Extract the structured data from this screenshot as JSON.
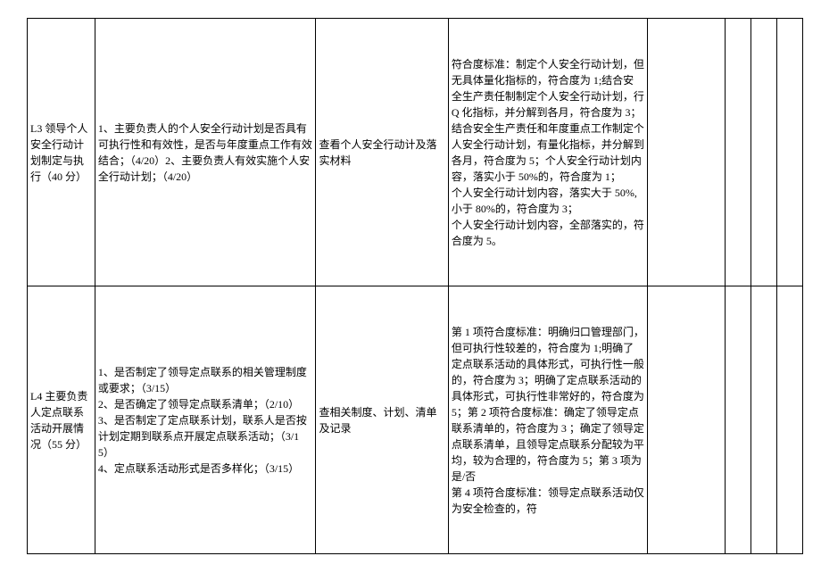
{
  "rows": [
    {
      "col1": "L3 领导个人安全行动计划制定与执行（40 分）",
      "col2": "1、主要负责人的个人安全行动计划是否具有可执行性和有效性，是否与年度重点工作有效结合；（4/20）2、主要负责人有效实施个人安全行动计划；（4/20）",
      "col3": "查看个人安全行动计及落实材料",
      "col4": "符合度标准：制定个人安全行动计划，但无具体量化指标的，符合度为 1;结合安全生产责任制制定个人安全行动计划，行 Q 化指标，并分解到各月，符合度为 3；结合安全生产责任和年度重点工作制定个人安全行动计划，有量化指标，并分解到各月，符合度为 5；个人安全行动计划内容，落实小于 50%的，符合度为 1；\n个人安全行动计划内容，落实大于 50%,小于 80%的，符合度为 3；\n个人安全行动计划内容，全部落实的，符合度为 5。",
      "col5": "",
      "col6": "",
      "col7": "",
      "col8": ""
    },
    {
      "col1": "L4 主要负责人定点联系活动开展情况（55 分）",
      "col2": "1、是否制定了领导定点联系的相关管理制度或要求；（3/15）\n2、是否确定了领导定点联系清单；（2/10）\n3、是否制定了定点联系计划，联系人是否按计划定期到联系点开展定点联系活动；（3/15）\n4、定点联系活动形式是否多样化；（3/15）",
      "col3": "查相关制度、计划、清单及记录",
      "col4": "第 1 项符合度标准：明确归口管理部门，但可执行性较差的，符合度为 1;明确了定点联系活动的具体形式，可执行性一般的，符合度为 3；明确了定点联系活动的具体形式，可执行性非常好的，符合度为 5；第 2 项符合度标准：确定了领导定点联系清单的，符合度为 3 ；确定了领导定点联系清单，且领导定点联系分配较为平均，较为合理的，符合度为 5；第 3 项为是/否\n第 4 项符合度标准：领导定点联系活动仅为安全检查的，符",
      "col5": "",
      "col6": "",
      "col7": "",
      "col8": ""
    }
  ]
}
